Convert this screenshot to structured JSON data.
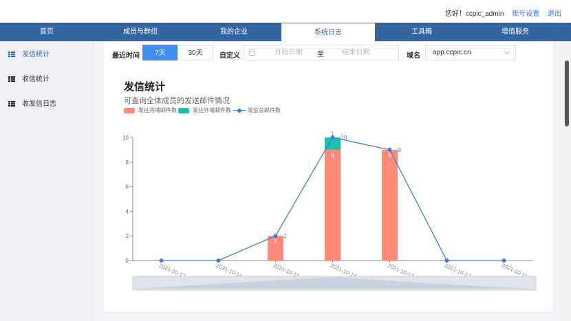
{
  "header": {
    "greeting": "您好！ccpic_admin",
    "account_link": "账号设置",
    "logout_link": "退出"
  },
  "nav": {
    "tabs": [
      "首页",
      "成员与群组",
      "我的企业",
      "系统日志",
      "工具箱",
      "增值服务"
    ],
    "active_index": 3
  },
  "sidebar": {
    "items": [
      {
        "label": "发信统计",
        "icon": "table-icon",
        "active": true
      },
      {
        "label": "收信统计",
        "icon": "table-icon",
        "active": false
      },
      {
        "label": "收发信日志",
        "icon": "table-icon",
        "active": false
      }
    ]
  },
  "filters": {
    "recent_label": "最近时间",
    "range_7": "7天",
    "range_30": "30天",
    "custom_label": "自定义",
    "start_placeholder": "开始日期",
    "range_sep": "至",
    "end_placeholder": "结束日期",
    "domain_label": "域名",
    "domain_value": "app.ccpic.cn"
  },
  "chart_title": "发信统计",
  "chart_subtitle": "可查询全体成员的发送邮件情况",
  "colors": {
    "nav_bg": "#3564a3",
    "accent": "#3f8ef0",
    "internal": "#ff8a78",
    "external": "#1fbfb0",
    "total": "#3f7de0"
  },
  "chart_data": {
    "type": "bar",
    "categories": [
      "2021-10-17",
      "2021-10-16",
      "2021-10-15",
      "2021-10-14",
      "2021-10-13",
      "2021-10-12",
      "2021-10-11"
    ],
    "series": [
      {
        "name": "发往内域邮件数",
        "type": "bar",
        "stack": "mail",
        "values": [
          0,
          0,
          2,
          9,
          9,
          0,
          0
        ]
      },
      {
        "name": "发往外域邮件数",
        "type": "bar",
        "stack": "mail",
        "values": [
          0,
          0,
          0,
          1,
          0,
          0,
          0
        ]
      },
      {
        "name": "发信总邮件数",
        "type": "line",
        "values": [
          0,
          0,
          2,
          10,
          9,
          0,
          0
        ]
      }
    ],
    "y_ticks": [
      "0",
      "2",
      "4",
      "6",
      "8",
      "10"
    ],
    "ylim": [
      0,
      10
    ],
    "legend_position": "top-left",
    "grid": false
  }
}
